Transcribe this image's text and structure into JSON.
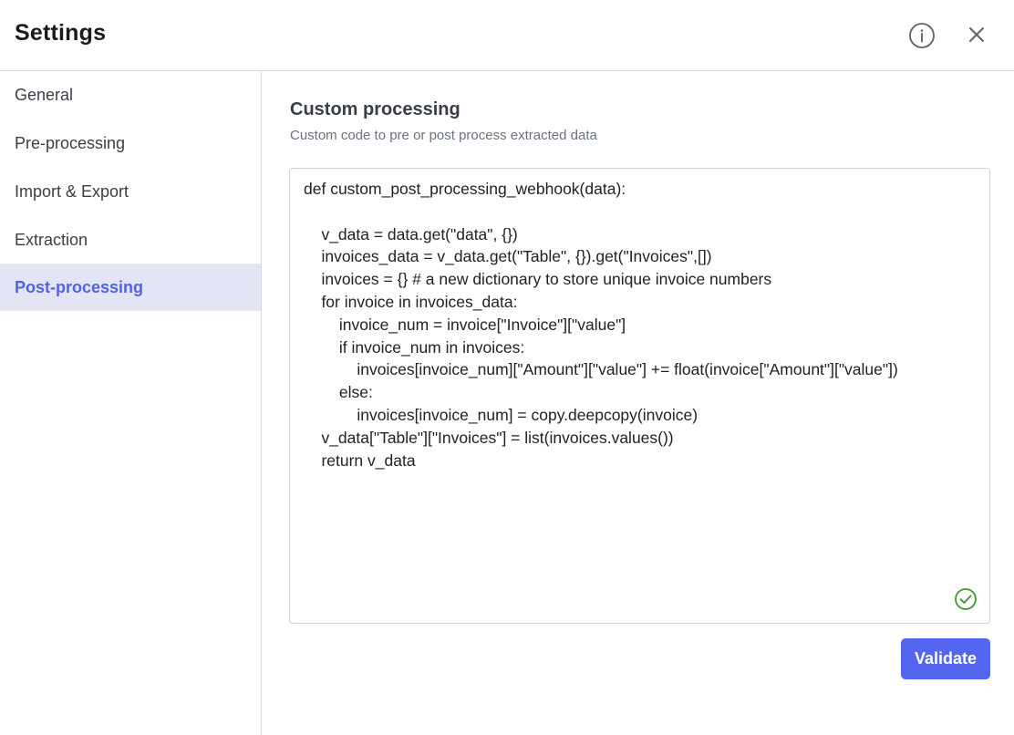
{
  "header": {
    "title": "Settings",
    "info_icon": "info-circle-icon",
    "close_icon": "close-icon"
  },
  "sidebar": {
    "items": [
      {
        "label": "General",
        "active": false
      },
      {
        "label": "Pre-processing",
        "active": false
      },
      {
        "label": "Import & Export",
        "active": false
      },
      {
        "label": "Extraction",
        "active": false
      },
      {
        "label": "Post-processing",
        "active": true
      }
    ]
  },
  "main": {
    "section_title": "Custom processing",
    "section_description": "Custom code to pre or post process extracted data",
    "code": "def custom_post_processing_webhook(data):\n\n    v_data = data.get(\"data\", {})\n    invoices_data = v_data.get(\"Table\", {}).get(\"Invoices\",[])\n    invoices = {} # a new dictionary to store unique invoice numbers\n    for invoice in invoices_data:\n        invoice_num = invoice[\"Invoice\"][\"value\"]\n        if invoice_num in invoices:\n            invoices[invoice_num][\"Amount\"][\"value\"] += float(invoice[\"Amount\"][\"value\"])\n        else:\n            invoices[invoice_num] = copy.deepcopy(invoice)\n    v_data[\"Table\"][\"Invoices\"] = list(invoices.values())\n    return v_data",
    "validation_status_icon": "check-circle-icon",
    "validate_label": "Validate"
  },
  "colors": {
    "accent": "#5465f0",
    "active_item_bg": "#e3e5f5",
    "active_item_text": "#5163e6",
    "success": "#3a9a2a"
  }
}
